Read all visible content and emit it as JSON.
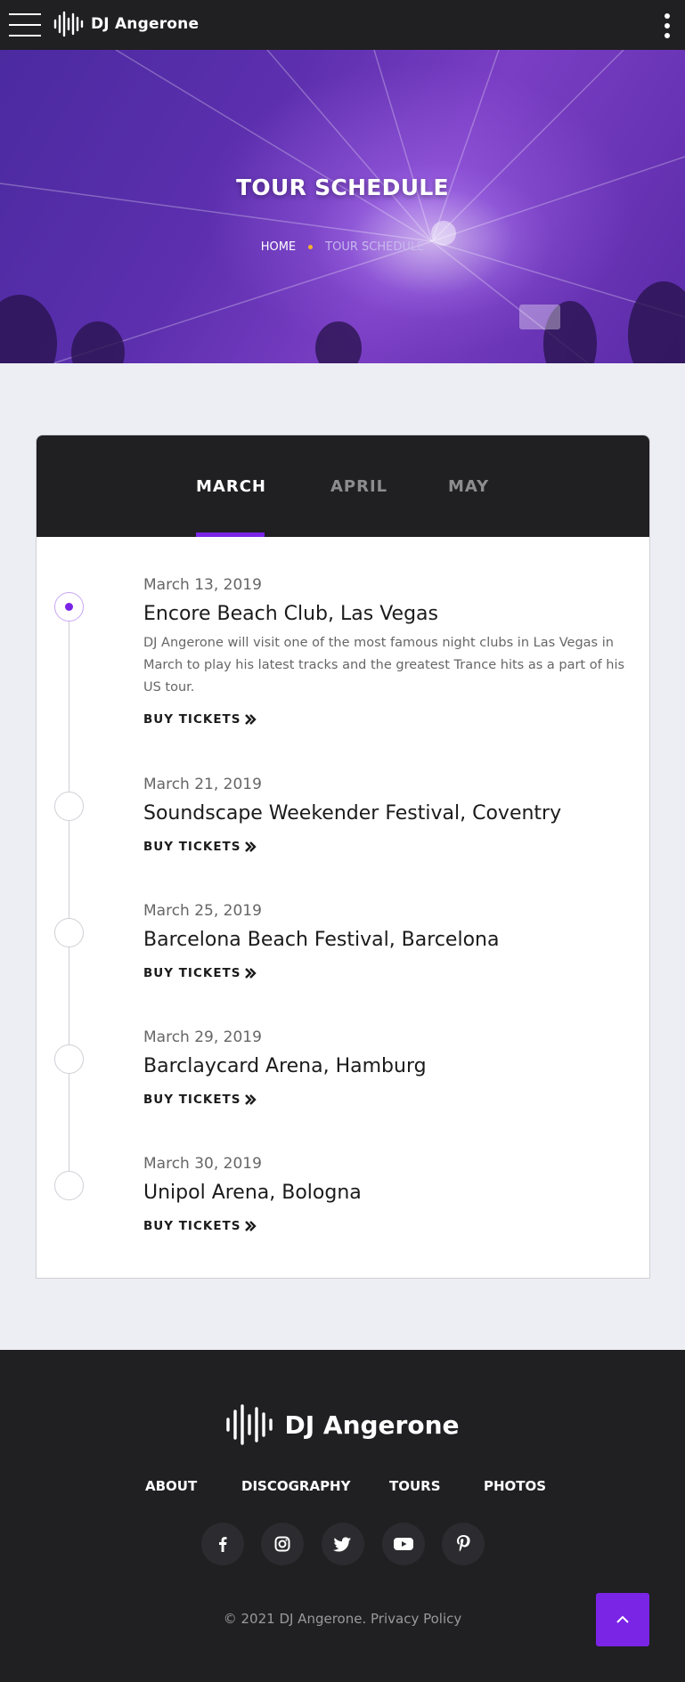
{
  "header": {
    "brand": "DJ Angerone",
    "menu_icon": "hamburger-icon",
    "more_icon": "kebab-menu-icon"
  },
  "hero": {
    "title": "TOUR SCHEDULE",
    "breadcrumb": {
      "home": "HOME",
      "current": "TOUR SCHEDULE"
    }
  },
  "schedule": {
    "tabs": [
      {
        "label": "MARCH",
        "active": true
      },
      {
        "label": "APRIL",
        "active": false
      },
      {
        "label": "MAY",
        "active": false
      }
    ],
    "events": [
      {
        "date": "March 13, 2019",
        "title": "Encore Beach Club, Las Vegas",
        "description": "DJ Angerone will visit one of the most famous night clubs in Las Vegas in March to play his latest tracks and the greatest Trance hits as a part of his US tour.",
        "cta": "BUY TICKETS",
        "active": true
      },
      {
        "date": "March 21, 2019",
        "title": "Soundscape Weekender Festival, Coventry",
        "cta": "BUY TICKETS"
      },
      {
        "date": "March 25, 2019",
        "title": "Barcelona Beach Festival, Barcelona",
        "cta": "BUY TICKETS"
      },
      {
        "date": "March 29, 2019",
        "title": "Barclaycard Arena, Hamburg",
        "cta": "BUY TICKETS"
      },
      {
        "date": "March 30, 2019",
        "title": "Unipol Arena, Bologna",
        "cta": "BUY TICKETS"
      }
    ]
  },
  "footer": {
    "brand": "DJ Angerone",
    "nav": [
      "ABOUT",
      "DISCOGRAPHY",
      "TOURS",
      "PHOTOS"
    ],
    "social": [
      "facebook-icon",
      "instagram-icon",
      "twitter-icon",
      "youtube-icon",
      "pinterest-icon"
    ],
    "copyright": "©  2021 DJ Angerone.",
    "policy": "Privacy Policy"
  },
  "colors": {
    "accent": "#7a24e6",
    "dark": "#201f22",
    "breadcrumb_dot": "#f3b22a",
    "page_bg": "#edeef3"
  }
}
